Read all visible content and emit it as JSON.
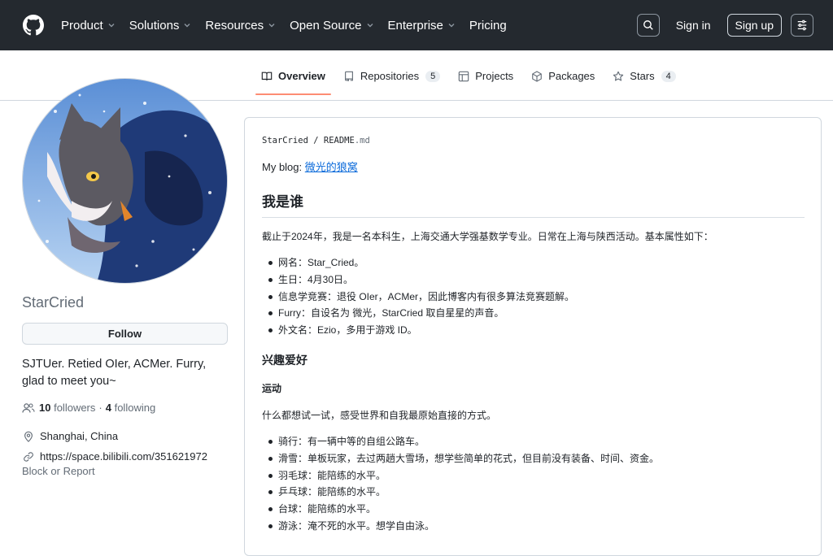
{
  "header": {
    "nav": [
      {
        "label": "Product",
        "dropdown": true
      },
      {
        "label": "Solutions",
        "dropdown": true
      },
      {
        "label": "Resources",
        "dropdown": true
      },
      {
        "label": "Open Source",
        "dropdown": true
      },
      {
        "label": "Enterprise",
        "dropdown": true
      },
      {
        "label": "Pricing",
        "dropdown": false
      }
    ],
    "sign_in": "Sign in",
    "sign_up": "Sign up"
  },
  "tabs": [
    {
      "label": "Overview",
      "icon": "book-icon",
      "active": true
    },
    {
      "label": "Repositories",
      "icon": "repo-icon",
      "count": "5"
    },
    {
      "label": "Projects",
      "icon": "table-icon"
    },
    {
      "label": "Packages",
      "icon": "package-icon"
    },
    {
      "label": "Stars",
      "icon": "star-icon",
      "count": "4"
    }
  ],
  "profile": {
    "username": "StarCried",
    "follow_label": "Follow",
    "bio": "SJTUer. Retied OIer, ACMer. Furry, glad to meet you~",
    "followers_count": "10",
    "followers_label": "followers",
    "separator": "·",
    "following_count": "4",
    "following_label": "following",
    "location": "Shanghai, China",
    "website": "https://space.bilibili.com/351621972",
    "block_label": "Block or Report"
  },
  "readme": {
    "path_owner": "StarCried",
    "path_sep": "/",
    "path_file": "README",
    "path_ext": ".md",
    "blog_prefix": "My blog: ",
    "blog_link": "微光的狼窝",
    "h_who": "我是谁",
    "intro": "截止于2024年，我是一名本科生，上海交通大学强基数学专业。日常在上海与陕西活动。基本属性如下：",
    "attrs": [
      "网名：Star_Cried。",
      "生日：4月30日。",
      "信息学竞赛：退役 OIer，ACMer，因此博客内有很多算法竞赛题解。",
      "Furry：自设名为 微光，StarCried 取自星星的声音。",
      "外文名：Ezio，多用于游戏 ID。"
    ],
    "h_hobby": "兴趣爱好",
    "h_sport": "运动",
    "sport_intro": "什么都想试一试，感受世界和自我最原始直接的方式。",
    "sports": [
      "骑行：有一辆中等的自组公路车。",
      "滑雪：单板玩家，去过两趟大雪场，想学些简单的花式，但目前没有装备、时间、资金。",
      "羽毛球：能陪练的水平。",
      "乒乓球：能陪练的水平。",
      "台球：能陪练的水平。",
      "游泳：淹不死的水平。想学自由泳。"
    ]
  }
}
